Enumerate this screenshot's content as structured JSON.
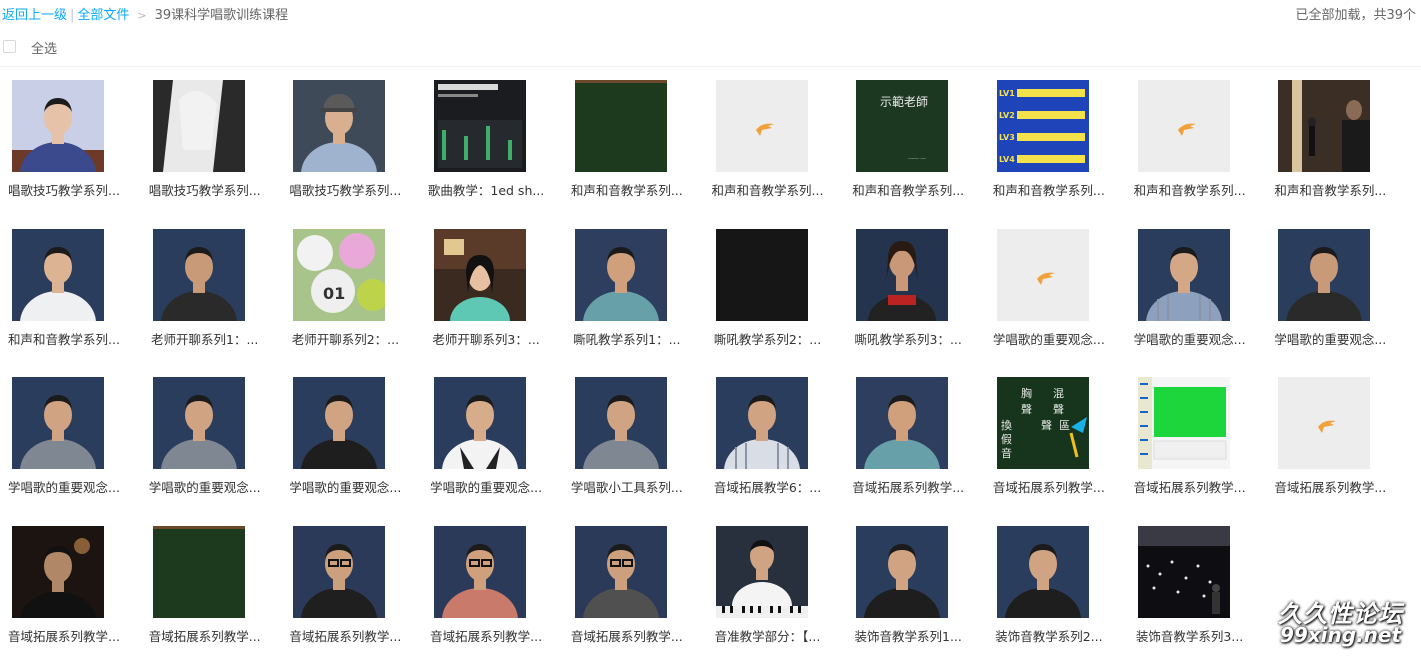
{
  "breadcrumb": {
    "back": "返回上一级",
    "divider": "|",
    "all_files": "全部文件",
    "arrow": ">",
    "current": "39课科学唱歌训练课程"
  },
  "status": "已全部加载，共39个",
  "select_all_label": "全选",
  "files": [
    {
      "name": "唱歌技巧教学系列...",
      "thumb": "person-blue-suit"
    },
    {
      "name": "唱歌技巧教学系列...",
      "thumb": "bw-woman"
    },
    {
      "name": "唱歌技巧教学系列...",
      "thumb": "man-cap"
    },
    {
      "name": "歌曲教学：1ed sh...",
      "thumb": "dark-ui"
    },
    {
      "name": "和声和音教学系列...",
      "thumb": "green-board"
    },
    {
      "name": "和声和音教学系列...",
      "thumb": "placeholder"
    },
    {
      "name": "和声和音教学系列...",
      "thumb": "green-board-text",
      "text": "示範老師"
    },
    {
      "name": "和声和音教学系列...",
      "thumb": "blue-levels",
      "text": [
        "LV1",
        "LV2",
        "LV3",
        "LV4"
      ]
    },
    {
      "name": "和声和音教学系列...",
      "thumb": "placeholder"
    },
    {
      "name": "和声和音教学系列...",
      "thumb": "dark-stage"
    },
    {
      "name": "和声和音教学系列...",
      "thumb": "man-white"
    },
    {
      "name": "老师开聊系列1：...",
      "thumb": "man-dark"
    },
    {
      "name": "老师开聊系列2：...",
      "thumb": "lottery-balls",
      "text": "01"
    },
    {
      "name": "老师开聊系列3：...",
      "thumb": "woman-room"
    },
    {
      "name": "嘶吼教学系列1：...",
      "thumb": "man-teal"
    },
    {
      "name": "嘶吼教学系列2：...",
      "thumb": "black"
    },
    {
      "name": "嘶吼教学系列3：...",
      "thumb": "woman-tank"
    },
    {
      "name": "学唱歌的重要观念...",
      "thumb": "placeholder"
    },
    {
      "name": "学唱歌的重要观念...",
      "thumb": "man-shirt"
    },
    {
      "name": "学唱歌的重要观念...",
      "thumb": "man-dark"
    },
    {
      "name": "学唱歌的重要观念...",
      "thumb": "man-grey"
    },
    {
      "name": "学唱歌的重要观念...",
      "thumb": "man-grey"
    },
    {
      "name": "学唱歌的重要观念...",
      "thumb": "man-black"
    },
    {
      "name": "学唱歌的重要观念...",
      "thumb": "man-vest"
    },
    {
      "name": "学唱歌小工具系列...",
      "thumb": "man-grey"
    },
    {
      "name": "音域拓展教学6：...",
      "thumb": "man-stripe"
    },
    {
      "name": "音域拓展系列教学...",
      "thumb": "man-teal"
    },
    {
      "name": "音域拓展系列教学...",
      "thumb": "green-board-chars",
      "text": [
        "胸",
        "混",
        "聲",
        "聲",
        "換",
        "聲",
        "區",
        "假",
        "音"
      ]
    },
    {
      "name": "音域拓展系列教学...",
      "thumb": "green-screen"
    },
    {
      "name": "音域拓展系列教学...",
      "thumb": "placeholder"
    },
    {
      "name": "音域拓展系列教学...",
      "thumb": "man-dark-room"
    },
    {
      "name": "音域拓展系列教学...",
      "thumb": "green-board"
    },
    {
      "name": "音域拓展系列教学...",
      "thumb": "man-glasses"
    },
    {
      "name": "音域拓展系列教学...",
      "thumb": "man-glasses-red"
    },
    {
      "name": "音域拓展系列教学...",
      "thumb": "man-glasses-dark"
    },
    {
      "name": "音准教学部分：【...",
      "thumb": "man-piano"
    },
    {
      "name": "装饰音教学系列1...",
      "thumb": "man-black"
    },
    {
      "name": "装饰音教学系列2...",
      "thumb": "man-black"
    },
    {
      "name": "装饰音教学系列3...",
      "thumb": "concert"
    }
  ],
  "watermark": {
    "line1": "久久性论坛",
    "line2": "99xing.net"
  },
  "colors": {
    "link": "#09aaff",
    "text": "#333333",
    "muted": "#666666"
  }
}
